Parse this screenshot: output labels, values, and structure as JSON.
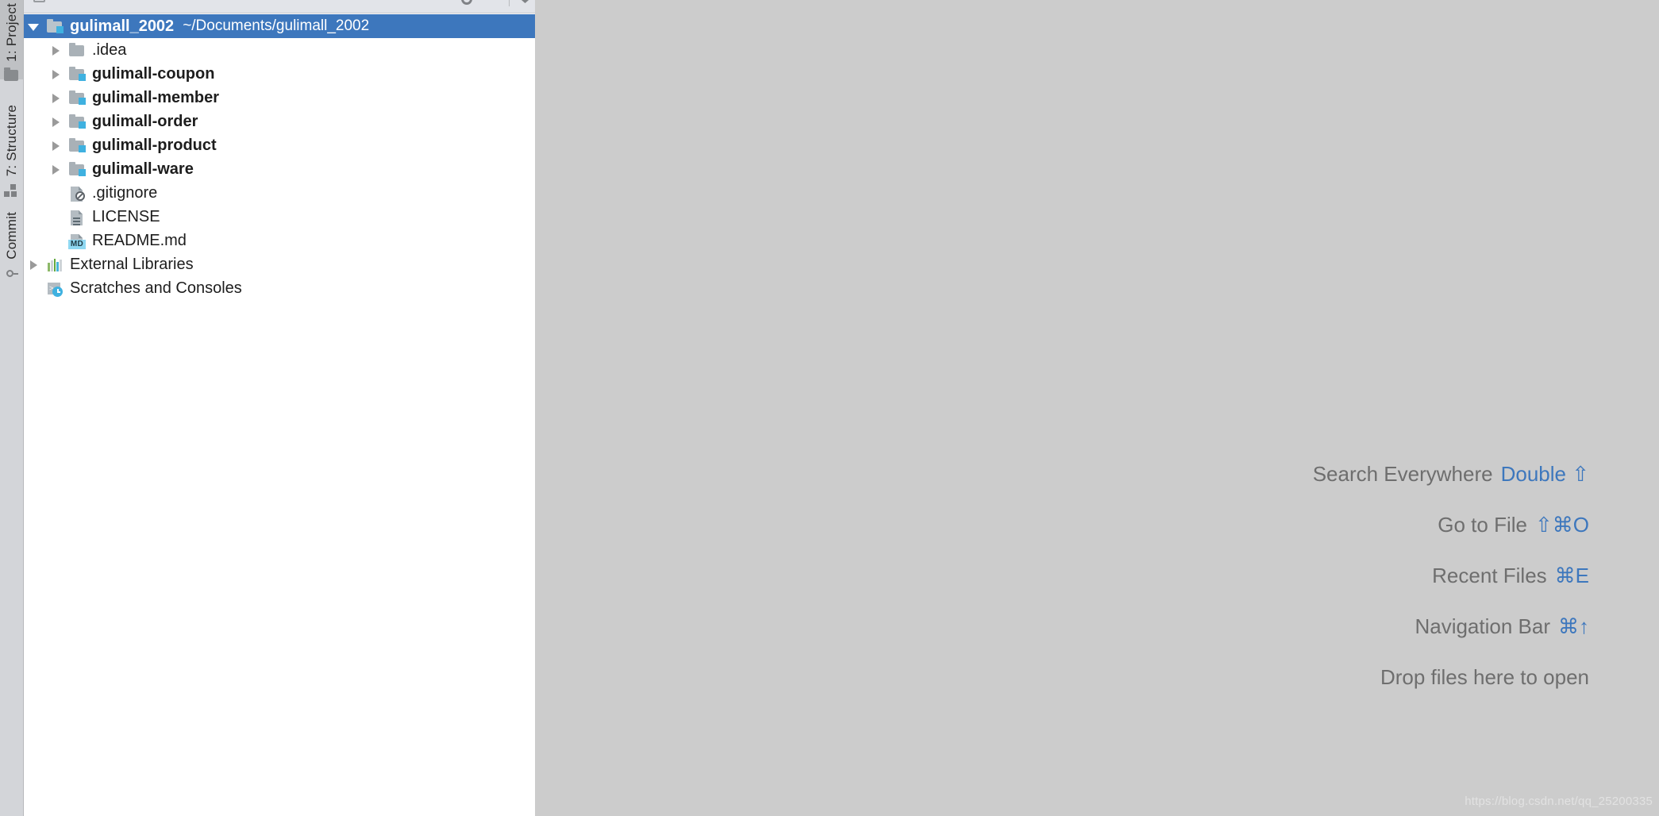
{
  "stripe": {
    "buttons": [
      {
        "label": "1: Project",
        "icon": "project-folder-icon",
        "active": true
      },
      {
        "label": "7: Structure",
        "icon": "structure-icon",
        "active": false
      },
      {
        "label": "Commit",
        "icon": "commit-icon",
        "active": false
      }
    ]
  },
  "toolbar": {
    "icons": [
      "select-opened-file-icon",
      "collapse-all-icon",
      "expand-all-icon",
      "settings-gear-icon",
      "hide-icon"
    ]
  },
  "tree": {
    "nodes": [
      {
        "label": "gulimall_2002",
        "sub": "~/Documents/gulimall_2002",
        "icon": "module-folder-icon",
        "arrow": "down",
        "selected": true,
        "bold": true,
        "indent": 0
      },
      {
        "label": ".idea",
        "sub": "",
        "icon": "folder-icon",
        "arrow": "right",
        "selected": false,
        "bold": false,
        "indent": 1
      },
      {
        "label": "gulimall-coupon",
        "sub": "",
        "icon": "module-folder-icon",
        "arrow": "right",
        "selected": false,
        "bold": true,
        "indent": 1
      },
      {
        "label": "gulimall-member",
        "sub": "",
        "icon": "module-folder-icon",
        "arrow": "right",
        "selected": false,
        "bold": true,
        "indent": 1
      },
      {
        "label": "gulimall-order",
        "sub": "",
        "icon": "module-folder-icon",
        "arrow": "right",
        "selected": false,
        "bold": true,
        "indent": 1
      },
      {
        "label": "gulimall-product",
        "sub": "",
        "icon": "module-folder-icon",
        "arrow": "right",
        "selected": false,
        "bold": true,
        "indent": 1
      },
      {
        "label": "gulimall-ware",
        "sub": "",
        "icon": "module-folder-icon",
        "arrow": "right",
        "selected": false,
        "bold": true,
        "indent": 1
      },
      {
        "label": ".gitignore",
        "sub": "",
        "icon": "gitignore-file-icon",
        "arrow": "none",
        "selected": false,
        "bold": false,
        "indent": 1
      },
      {
        "label": "LICENSE",
        "sub": "",
        "icon": "text-file-icon",
        "arrow": "none",
        "selected": false,
        "bold": false,
        "indent": 1
      },
      {
        "label": "README.md",
        "sub": "",
        "icon": "markdown-file-icon",
        "arrow": "none",
        "selected": false,
        "bold": false,
        "indent": 1
      },
      {
        "label": "External Libraries",
        "sub": "",
        "icon": "external-libraries-icon",
        "arrow": "right",
        "selected": false,
        "bold": false,
        "indent": 0
      },
      {
        "label": "Scratches and Consoles",
        "sub": "",
        "icon": "scratches-icon",
        "arrow": "none",
        "selected": false,
        "bold": false,
        "indent": 0
      }
    ]
  },
  "editor": {
    "shortcuts": [
      {
        "action": "Search Everywhere",
        "keys": "Double ⇧"
      },
      {
        "action": "Go to File",
        "keys": "⇧⌘O"
      },
      {
        "action": "Recent Files",
        "keys": "⌘E"
      },
      {
        "action": "Navigation Bar",
        "keys": "⌘↑"
      },
      {
        "action": "Drop files here to open",
        "keys": ""
      }
    ],
    "watermark": "https://blog.csdn.net/qq_25200335"
  },
  "colors": {
    "selection": "#3d77bd",
    "editor_bg": "#cccccc",
    "stripe_bg": "#d3d5d9",
    "stripe_active": "#bfc1c4",
    "shortcut_key": "#3d77bd",
    "module_badge": "#3fb1e0"
  }
}
